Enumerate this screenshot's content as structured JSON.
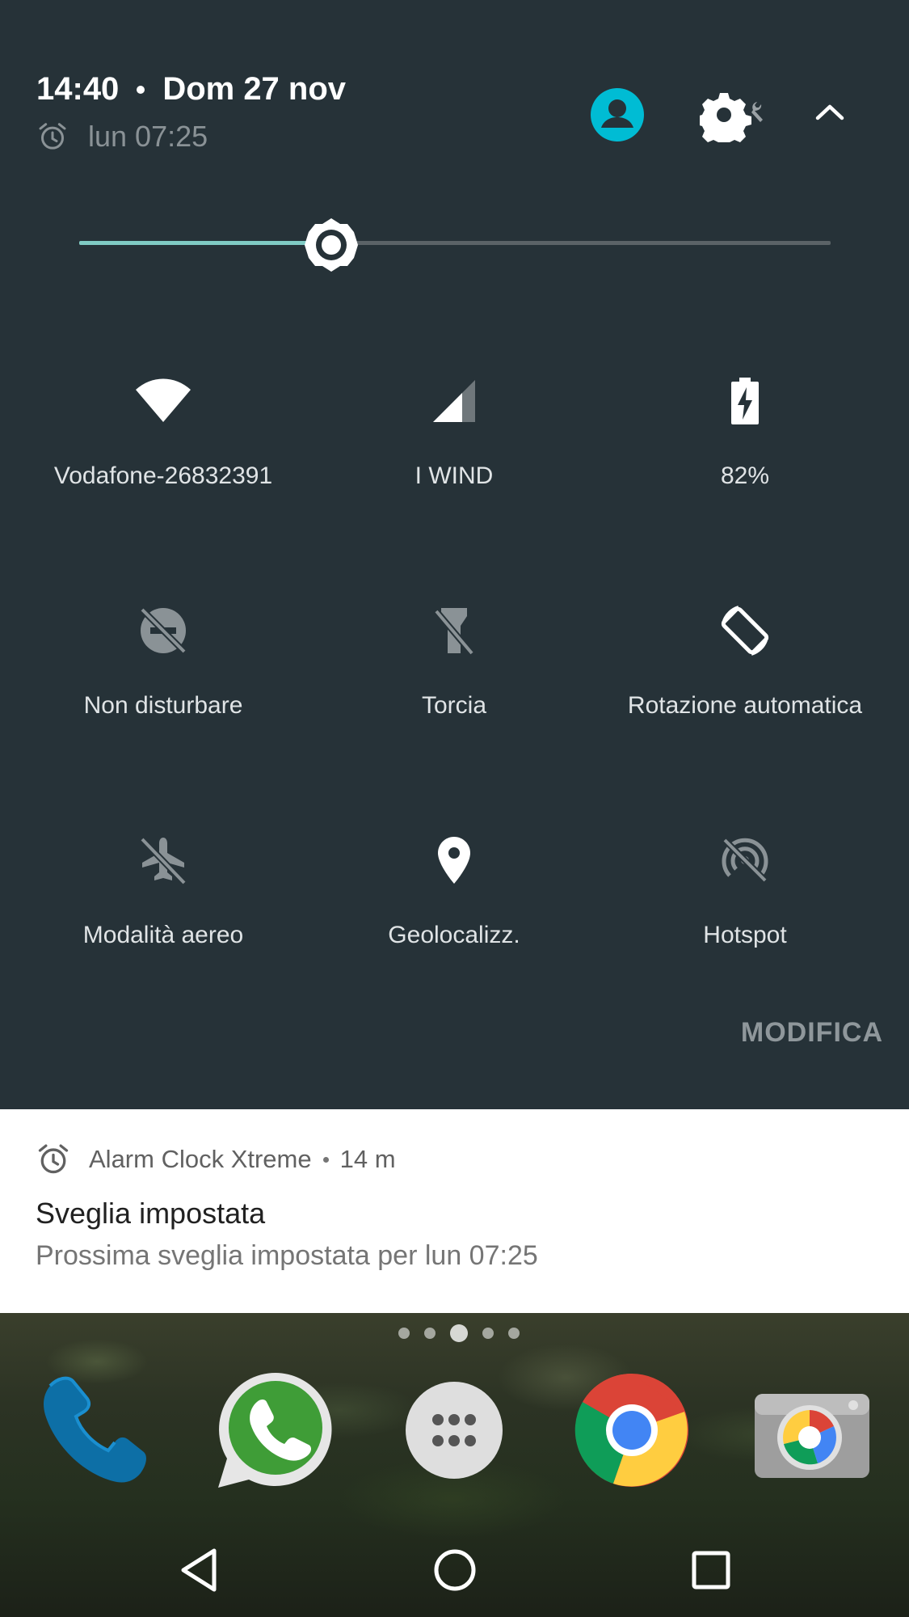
{
  "status": {
    "time": "14:40",
    "date": "Dom 27 nov",
    "next_alarm": "lun 07:25"
  },
  "header_icons": [
    "user-avatar-icon",
    "settings-gear-icon",
    "wrench-icon",
    "collapse-chevron-icon"
  ],
  "brightness": {
    "level": 0.335,
    "accent": "#80cbc4"
  },
  "tiles": [
    {
      "label": "Vodafone-26832391",
      "icon": "wifi-icon",
      "active": true
    },
    {
      "label": "I WIND",
      "icon": "cellular-signal-icon",
      "active": true
    },
    {
      "label": "82%",
      "icon": "battery-charging-icon",
      "active": true
    },
    {
      "label": "Non disturbare",
      "icon": "do-not-disturb-off-icon",
      "active": false
    },
    {
      "label": "Torcia",
      "icon": "flashlight-off-icon",
      "active": false
    },
    {
      "label": "Rotazione automatica",
      "icon": "auto-rotate-icon",
      "active": true
    },
    {
      "label": "Modalità aereo",
      "icon": "airplane-off-icon",
      "active": false
    },
    {
      "label": "Geolocalizz.",
      "icon": "location-pin-icon",
      "active": true
    },
    {
      "label": "Hotspot",
      "icon": "hotspot-off-icon",
      "active": false
    }
  ],
  "edit_label": "MODIFICA",
  "notification": {
    "app": "Alarm Clock Xtreme",
    "age": "14 m",
    "title": "Sveglia impostata",
    "text": "Prossima sveglia impostata per lun 07:25"
  },
  "home": {
    "page_count": 5,
    "active_page": 3,
    "dock_apps": [
      "phone-icon",
      "whatsapp-icon",
      "app-drawer-icon",
      "chrome-icon",
      "camera-icon"
    ]
  },
  "colors": {
    "shade_bg": "#263238",
    "avatar": "#00bcd4",
    "icon_active": "#ffffff",
    "icon_inactive": "#8a9296"
  }
}
